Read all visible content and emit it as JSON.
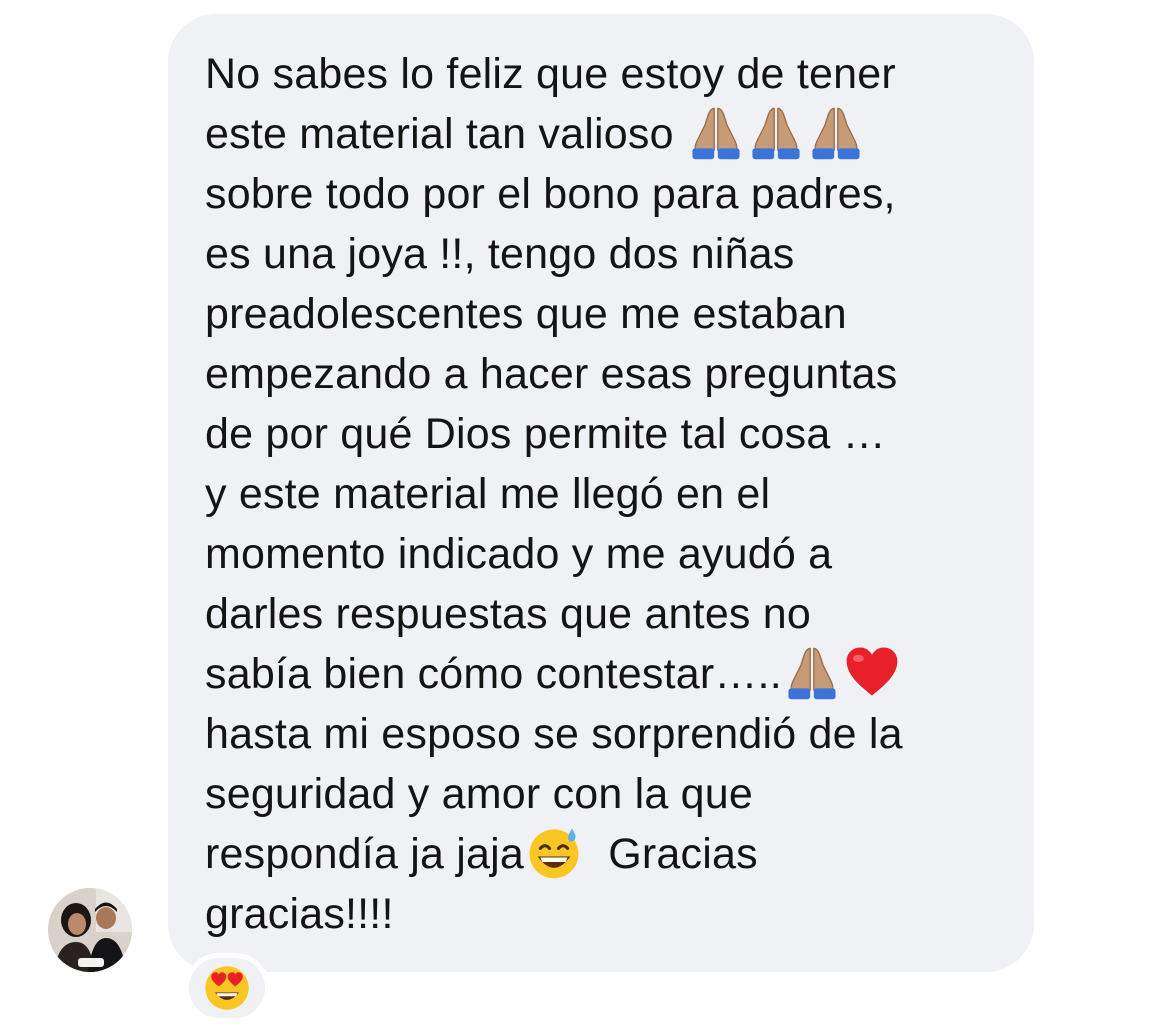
{
  "message": {
    "lines": [
      "No sabes lo feliz que estoy de tener",
      "este material tan valioso",
      "sobre todo por el bono para padres,",
      "es una joya !!, tengo dos niñas",
      "preadolescentes que me estaban",
      "empezando a hacer esas preguntas",
      "de por qué Dios permite tal cosa …",
      "y este material me llegó en el",
      "momento indicado y me ayudó a",
      "darles respuestas que antes no",
      "sabía bien cómo contestar…..",
      "hasta mi esposo se sorprendió de la",
      "seguridad y amor con la que",
      "respondía  ja jaja",
      "Gracias",
      "gracias!!!!"
    ],
    "emojis": {
      "line2": [
        "folded-hands-icon",
        "folded-hands-icon",
        "folded-hands-icon"
      ],
      "line11": [
        "folded-hands-icon",
        "red-heart-icon"
      ],
      "line14": [
        "grinning-sweat-icon"
      ]
    },
    "colors": {
      "bubble": "#f0f1f4",
      "text": "#141414"
    }
  },
  "sender": {
    "avatar": "avatar"
  },
  "reaction": {
    "emoji": "heart-eyes-icon"
  }
}
